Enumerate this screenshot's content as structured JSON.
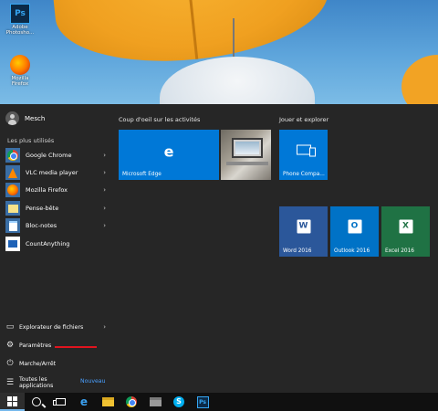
{
  "desktop": {
    "icons": [
      {
        "name": "Adobe Photoshop",
        "label": "Adobe\nPhotosho...",
        "badge": "Ps"
      },
      {
        "name": "Mozilla Firefox",
        "label": "Mozilla\nFirefox"
      }
    ]
  },
  "start_menu": {
    "user": {
      "name": "Mesch"
    },
    "most_used_title": "Les plus utilisés",
    "apps": [
      {
        "label": "Google Chrome",
        "chevron": "›"
      },
      {
        "label": "VLC media player",
        "chevron": "›"
      },
      {
        "label": "Mozilla Firefox",
        "chevron": "›"
      },
      {
        "label": "Pense-bête",
        "chevron": "›"
      },
      {
        "label": "Bloc-notes",
        "chevron": "›"
      },
      {
        "label": "CountAnything",
        "chevron": ""
      }
    ],
    "bottom": {
      "explorer": "Explorateur de fichiers",
      "explorer_chevron": "›",
      "settings": "Paramètres",
      "power": "Marche/Arrêt",
      "all_apps": "Toutes les\napplications",
      "new_badge": "Nouveau"
    },
    "groups": {
      "activities_title": "Coup d'oeil sur les activités",
      "explore_title": "Jouer et explorer"
    },
    "tiles": {
      "edge": "Microsoft Edge",
      "phone": "Phone Compa...",
      "word": "Word 2016",
      "outlook": "Outlook 2016",
      "excel": "Excel 2016",
      "word_letter": "W",
      "outlook_letter": "O",
      "excel_letter": "X",
      "edge_letter": "e"
    }
  },
  "taskbar": {
    "items": [
      "start",
      "search",
      "task-view",
      "edge",
      "file-explorer",
      "chrome",
      "libraries",
      "skype",
      "photoshop"
    ],
    "edge_letter": "e",
    "skype_letter": "S",
    "ps_letter": "Ps"
  },
  "colors": {
    "accent": "#0078d7",
    "menu_bg": "#262626",
    "taskbar_bg": "#101010",
    "highlight_underline": "#e0141e",
    "new_badge": "#4aa0ff"
  }
}
